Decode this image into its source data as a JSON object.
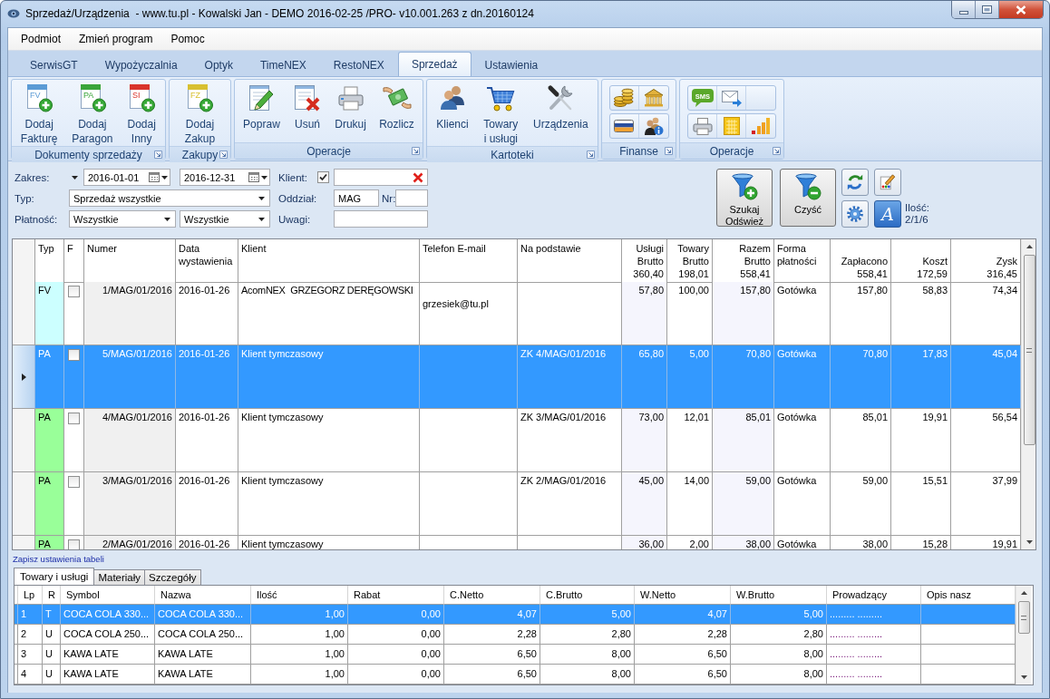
{
  "window": {
    "title": "Sprzedaż/Urządzenia  - www.tu.pl - Kowalski Jan - DEMO 2016-02-25 /PRO- v10.001.263 z dn.20160124"
  },
  "menu": [
    "Podmiot",
    "Zmień program",
    "Pomoc"
  ],
  "tabs": [
    {
      "label": "SerwisGT",
      "selected": false
    },
    {
      "label": "Wypożyczalnia",
      "selected": false
    },
    {
      "label": "Optyk",
      "selected": false
    },
    {
      "label": "TimeNEX",
      "selected": false
    },
    {
      "label": "RestoNEX",
      "selected": false
    },
    {
      "label": "Sprzedaż",
      "selected": true
    },
    {
      "label": "Ustawienia",
      "selected": false
    }
  ],
  "ribbon": {
    "groups": [
      {
        "label": "Dokumenty sprzedaży",
        "kind": "large",
        "buttons": [
          {
            "label": "Dodaj\nFakturę",
            "tag": "FV",
            "color": "#5b9bd5"
          },
          {
            "label": "Dodaj\nParagon",
            "tag": "PA",
            "color": "#3aa53a"
          },
          {
            "label": "Dodaj\nInny",
            "tag": "SI",
            "color": "#d9342b"
          }
        ]
      },
      {
        "label": "Zakupy",
        "kind": "large",
        "buttons": [
          {
            "label": "Dodaj\nZakup",
            "tag": "FZ",
            "color": "#d8c030"
          }
        ]
      },
      {
        "label": "Operacje",
        "kind": "large",
        "buttons": [
          {
            "label": "Popraw"
          },
          {
            "label": "Usuń"
          },
          {
            "label": "Drukuj"
          },
          {
            "label": "Rozlicz"
          }
        ]
      },
      {
        "label": "Kartoteki",
        "kind": "large",
        "buttons": [
          {
            "label": "Klienci"
          },
          {
            "label": "Towary\ni usługi"
          },
          {
            "label": "Urządzenia"
          }
        ]
      },
      {
        "label": "Finanse",
        "kind": "small"
      },
      {
        "label": "Operacje",
        "kind": "small",
        "sms": "SMS"
      }
    ]
  },
  "filters": {
    "range": {
      "label": "Zakres:",
      "from": "2016-01-01",
      "to": "2016-12-31"
    },
    "type": {
      "label": "Typ:",
      "value": "Sprzedaż wszystkie"
    },
    "payment": {
      "label": "Płatność:",
      "value": "Wszystkie",
      "value_2": "Wszystkie"
    },
    "client": {
      "label": "Klient:",
      "checked": true
    },
    "branch": {
      "label": "Oddział:",
      "value": "MAG"
    },
    "number": {
      "label": "Nr:"
    },
    "notes": {
      "label": "Uwagi:"
    },
    "search_button": "Szukaj\nOdśwież",
    "clear_button": "Czyść",
    "font_button": "A",
    "count": {
      "label": "Ilość:",
      "value": "2/1/6"
    }
  },
  "grid": {
    "columns": [
      {
        "label": "Typ"
      },
      {
        "label": "F"
      },
      {
        "label": "Numer"
      },
      {
        "label": "Data\nwystawienia"
      },
      {
        "label": "Klient"
      },
      {
        "label": "Telefon E-mail"
      },
      {
        "label": "Na podstawie"
      },
      {
        "label": "Usługi\nBrutto",
        "total": "360,40"
      },
      {
        "label": "Towary\nBrutto",
        "total": "198,01"
      },
      {
        "label": "Razem\nBrutto",
        "total": "558,41"
      },
      {
        "label": "Forma\npłatności"
      },
      {
        "label": "Zapłacono",
        "total": "558,41"
      },
      {
        "label": "Koszt",
        "total": "172,59"
      },
      {
        "label": "Zysk",
        "total": "316,45"
      }
    ],
    "rows": [
      {
        "selected": false,
        "type": "FV",
        "color": "#ccffff",
        "checked": false,
        "number": "1/MAG/01/2016",
        "date": "2016-01-26",
        "client": "AcomNEX  GRZEGORZ DERĘGOWSKI",
        "email": "grzesiek@tu.pl",
        "services": "57,80",
        "goods": "100,00",
        "gross": "157,80",
        "payment": "Gotówka",
        "paid": "157,80",
        "cost": "58,83",
        "profit": "74,34"
      },
      {
        "selected": true,
        "type": "PA",
        "checked": false,
        "number": "5/MAG/01/2016",
        "date": "2016-01-26",
        "client": "Klient tymczasowy",
        "based_on": "ZK 4/MAG/01/2016",
        "services": "65,80",
        "goods": "5,00",
        "gross": "70,80",
        "payment": "Gotówka",
        "paid": "70,80",
        "cost": "17,83",
        "profit": "45,04"
      },
      {
        "selected": false,
        "type": "PA",
        "color": "#99ff99",
        "checked": false,
        "number": "4/MAG/01/2016",
        "date": "2016-01-26",
        "client": "Klient tymczasowy",
        "based_on": "ZK 3/MAG/01/2016",
        "services": "73,00",
        "goods": "12,01",
        "gross": "85,01",
        "payment": "Gotówka",
        "paid": "85,01",
        "cost": "19,91",
        "profit": "56,54"
      },
      {
        "selected": false,
        "type": "PA",
        "color": "#99ff99",
        "checked": false,
        "number": "3/MAG/01/2016",
        "date": "2016-01-26",
        "client": "Klient tymczasowy",
        "based_on": "ZK 2/MAG/01/2016",
        "services": "45,00",
        "goods": "14,00",
        "gross": "59,00",
        "payment": "Gotówka",
        "paid": "59,00",
        "cost": "15,51",
        "profit": "37,99"
      },
      {
        "selected": false,
        "type": "PA",
        "color": "#99ff99",
        "checked": false,
        "number": "2/MAG/01/2016",
        "date": "2016-01-26",
        "client": "Klient tymczasowy",
        "services": "36,00",
        "goods": "2,00",
        "gross": "38,00",
        "payment": "Gotówka",
        "paid": "38,00",
        "cost": "15,28",
        "profit": "19,91"
      }
    ]
  },
  "save_settings_link": "Zapisz ustawienia tabeli",
  "detail_tabs": [
    {
      "label": "Towary i usługi",
      "selected": true
    },
    {
      "label": "Materiały",
      "selected": false
    },
    {
      "label": "Szczegóły",
      "selected": false
    }
  ],
  "items": {
    "columns": [
      "Lp",
      "R",
      "Symbol",
      "Nazwa",
      "Ilość",
      "Rabat",
      "C.Netto",
      "C.Brutto",
      "W.Netto",
      "W.Brutto",
      "Prowadzący",
      "Opis nasz"
    ],
    "rows": [
      {
        "selected": true,
        "cells": [
          "1",
          "T",
          "COCA COLA 330...",
          "COCA COLA 330...",
          "1,00",
          "0,00",
          "4,07",
          "5,00",
          "4,07",
          "5,00",
          "......... ........."
        ]
      },
      {
        "selected": false,
        "cells": [
          "2",
          "U",
          "COCA COLA 250...",
          "COCA COLA 250...",
          "1,00",
          "0,00",
          "2,28",
          "2,80",
          "2,28",
          "2,80",
          "......... ........."
        ]
      },
      {
        "selected": false,
        "cells": [
          "3",
          "U",
          "KAWA LATE",
          "KAWA LATE",
          "1,00",
          "0,00",
          "6,50",
          "8,00",
          "6,50",
          "8,00",
          "......... ........."
        ]
      },
      {
        "selected": false,
        "cells": [
          "4",
          "U",
          "KAWA LATE",
          "KAWA LATE",
          "1,00",
          "0,00",
          "6,50",
          "8,00",
          "6,50",
          "8,00",
          "......... ........."
        ]
      }
    ]
  }
}
